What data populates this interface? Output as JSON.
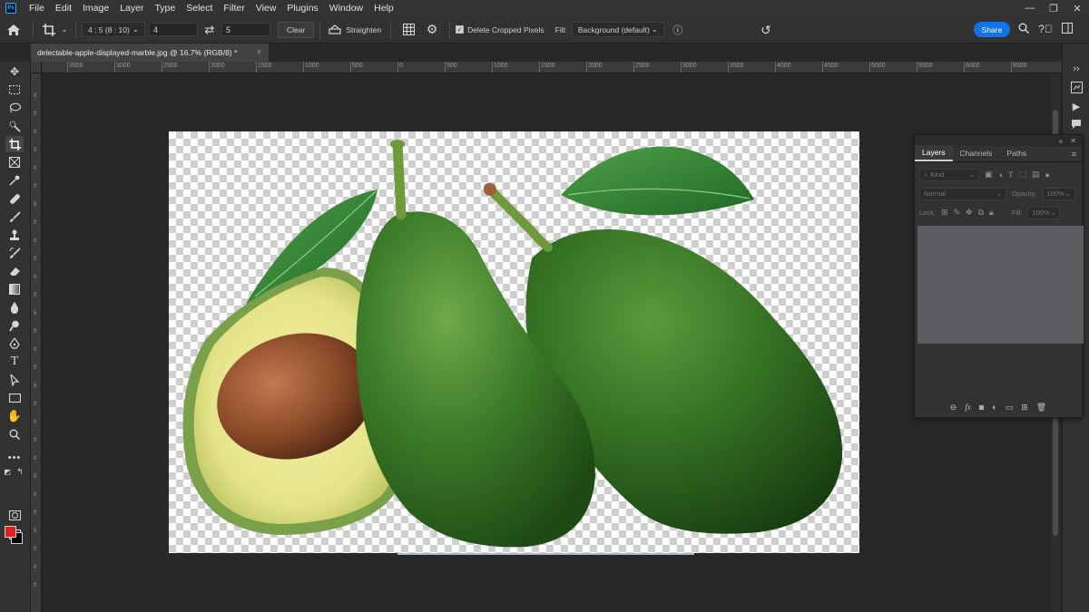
{
  "menubar": {
    "items": [
      "File",
      "Edit",
      "Image",
      "Layer",
      "Type",
      "Select",
      "Filter",
      "View",
      "Plugins",
      "Window",
      "Help"
    ],
    "logo": "Ps"
  },
  "options": {
    "ratio_preset": "4 : 5 (8 : 10)",
    "width_value": "4",
    "height_value": "5",
    "clear_label": "Clear",
    "straighten_label": "Straighten",
    "delete_cropped_label": "Delete Cropped Pixels",
    "fill_label": "Fill:",
    "fill_value": "Background (default)",
    "share_label": "Share"
  },
  "document": {
    "tab_title": "delectable-apple-displayed-marble.jpg @ 16.7% (RGB/8) *",
    "close_glyph": "×"
  },
  "ruler_top": [
    "3500",
    "3000",
    "2500",
    "2000",
    "1500",
    "1000",
    "500",
    "0",
    "500",
    "1000",
    "1500",
    "2000",
    "2500",
    "3000",
    "3500",
    "4000",
    "4500",
    "5000",
    "5500",
    "6000",
    "6500"
  ],
  "ruler_left": [
    "0",
    "0",
    "0",
    "5",
    "0",
    "0",
    "5",
    "0",
    "0",
    "0",
    "0",
    "0",
    "5",
    "0",
    "0",
    "0",
    "5",
    "0",
    "0",
    "0",
    "0",
    "5",
    "0",
    "0",
    "5",
    "0",
    "0",
    "0"
  ],
  "layers_panel": {
    "tabs": [
      "Layers",
      "Channels",
      "Paths"
    ],
    "kind_label": "Kind",
    "blend_mode": "Normal",
    "opacity_label": "Opacity:",
    "opacity_value": "100%",
    "lock_label": "Lock:",
    "fill_label": "Fill:",
    "fill_value": "100%"
  },
  "colors": {
    "foreground": "#e02020",
    "background": "#000000",
    "accent": "#1473e6"
  }
}
